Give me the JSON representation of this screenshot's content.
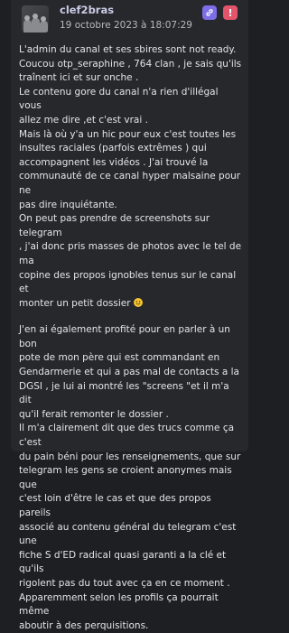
{
  "post": {
    "username": "clef2bras",
    "date": "19 octobre 2023 à 18:07:29",
    "paragraph1_lines": [
      "L'admin du canal et ses sbires sont not ready.",
      "Coucou otp_seraphine , 764 clan , je sais qu'ils",
      "traînent ici et sur onche .",
      "Le contenu gore du canal n'a rien d'illégal vous",
      "allez me dire ,et c'est vrai .",
      "Mais là où y'a un hic pour eux c'est toutes les",
      "insultes raciales (parfois extrêmes ) qui",
      "accompagnent les vidéos . J'ai trouvé la",
      "communauté de ce canal hyper malsaine pour ne",
      "pas dire inquiétante.",
      "On peut pas prendre de screenshots sur telegram",
      ", j'ai donc pris masses de photos avec le tel de ma",
      "copine des propos ignobles tenus sur le canal et",
      "monter un petit dossier"
    ],
    "paragraph2_lines": [
      "J'en ai également profité pour en parler à un bon",
      "pote de mon père qui est commandant en",
      "Gendarmerie et qui a pas mal de contacts a la",
      "DGSI , je lui ai montré les \"screens \"et il m'a dit",
      "qu'il ferait remonter le dossier .",
      "Il m'a clairement dit que des trucs comme ça c'est",
      "du pain béni pour les renseignements, que sur",
      "telegram les gens se croient anonymes mais que",
      "c'est loin d'être le cas et que des propos pareils",
      "associé au contenu général du telegram c'est une",
      "fiche S d'ED radical quasi garanti a la clé et qu'ils",
      "rigolent pas du tout avec ça en ce moment .",
      "Apparemment selon les profils ça pourrait même",
      "aboutir à des perquisitions."
    ],
    "report_label": "!",
    "icons": {
      "avatar": "avatar-image",
      "link": "link-icon",
      "report": "report-icon",
      "emoji": "smiley-emoji"
    }
  }
}
